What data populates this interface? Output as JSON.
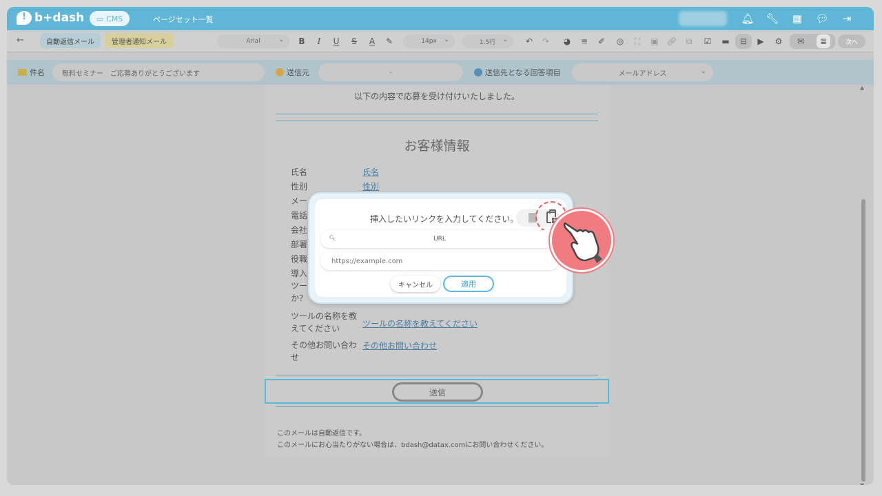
{
  "app": {
    "logo_text": "b+dash",
    "cms_label": "CMS",
    "page_title": "ページセット一覧"
  },
  "toolbar": {
    "tabs": [
      {
        "label": "自動返信メール",
        "active": true
      },
      {
        "label": "管理者通知メール",
        "active": false
      }
    ],
    "font": "Arial",
    "font_size": "14px",
    "line_height": "1.5行",
    "next_label": "次へ"
  },
  "fields": {
    "subject_label": "件名",
    "subject_value": "無料セミナー　ご応募ありがとうございます",
    "sender_label": "送信元",
    "sender_value": "-",
    "recipient_label": "送信先となる回答項目",
    "recipient_value": "メールアドレス"
  },
  "email": {
    "intro": "以下の内容で応募を受け付けいたしました。",
    "section_title": "お客様情報",
    "rows": [
      {
        "key": "氏名",
        "value": "氏名"
      },
      {
        "key": "性別",
        "value": "性別"
      },
      {
        "key": "メール",
        "value": ""
      },
      {
        "key": "電話",
        "value": ""
      },
      {
        "key": "会社",
        "value": ""
      },
      {
        "key": "部署",
        "value": ""
      },
      {
        "key": "役職",
        "value": ""
      },
      {
        "key": "導入\nツー\nか？",
        "value": ""
      },
      {
        "key": "ツールの名称を教えてください",
        "value": "ツールの名称を教えてください"
      },
      {
        "key": "その他お問い合わせ",
        "value": "その他お問い合わせ"
      }
    ],
    "send_label": "送信",
    "footer_line1": "このメールは自動返信です。",
    "footer_line2": "このメールにお心当たりがない場合は、bdash@datax.comにお問い合わせください。"
  },
  "modal": {
    "title": "挿入したいリンクを入力してください。",
    "url_label": "URL",
    "url_placeholder": "https://example.com",
    "cancel_label": "キャンセル",
    "apply_label": "適用"
  },
  "colors": {
    "brand": "#5fb6d6",
    "highlight": "#e85c6a",
    "link": "#4a80a6"
  }
}
